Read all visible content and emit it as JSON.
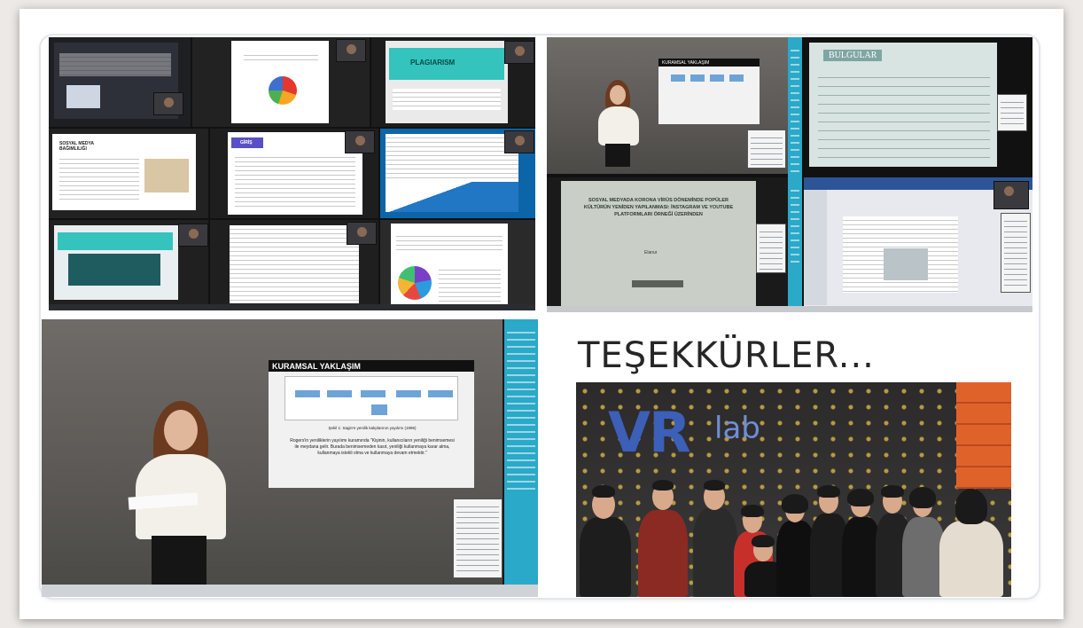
{
  "collage": {
    "thanks_heading": "TEŞEKKÜRLER...",
    "photo_logo_vr": "VR",
    "photo_logo_lab": "lab"
  },
  "screens": {
    "a1_title": "PLAGIARISM",
    "a2_title": "GİRİŞ",
    "a3_heading": "SOSYAL MEDYA BAĞIMLILIĞI",
    "b1_heading": "KURAMSAL YAKLAŞIM",
    "b2_heading": "BULGULAR",
    "b3_thesis_title": "SOSYAL MEDYADA KORONA VİRÜS DÖNEMİNDE POPÜLER KÜLTÜRÜN YENİDEN YAPILANMASI: İNSTAGRAM VE YOUTUBE PLATFORMLARI ÖRNEĞİ ÜZERİNDEN",
    "b3_author": "Elanur",
    "c_heading": "KURAMSAL YAKLAŞIM",
    "c_caption": "Şekil 1: Sagin'e yenilik kalıplarının yayılımı (1995)",
    "c_quote": "Rogers'in yeniliklerin yayılımı kuramında \"Kişinin, kullanıcıların yeniliği benimsemesi ile meydana gelir. Burada benimsemeden kasıt, yeniliği kullanmaya karar alma, kullanmaya istekli olma ve kullanmaya devam etmektir.\""
  },
  "colors": {
    "accent_cyan": "#2aa9c8",
    "teal_slide": "#34c3bd",
    "logo_blue": "#3c5fb8"
  }
}
